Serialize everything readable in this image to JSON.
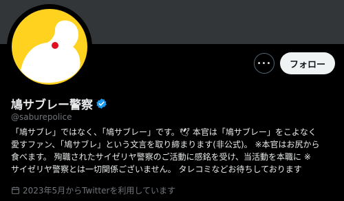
{
  "profile": {
    "name": "鳩サブレー警察",
    "handle": "@saburepolice",
    "bio_lines": [
      "「鳩サブレ」ではなく、「鳩サブレー」です。🕊 本官は「鳩サブレー」をこよなく",
      "愛すファン、「鳩サブレ」という文言を取り締まります(非公式)。 ※本官はお尻から",
      "食べます。 殉職されたサイゼリヤ警察のご活動に感銘を受け、当活動を本職に ※",
      "サイゼリヤ警察とは一切関係ございません。 タレコミなどお待ちしております"
    ],
    "joined": "2023年5月からTwitterを利用しています",
    "verified": true
  },
  "actions": {
    "more_label": "•••",
    "follow_label": "フォロー"
  },
  "colors": {
    "avatar_bg": "#ffd21f",
    "banner": "#333639",
    "verified": "#1d9bf0",
    "follow_bg": "#eff3f4"
  },
  "icons": [
    "dove-avatar",
    "verified-badge-icon",
    "more-icon",
    "calendar-icon"
  ]
}
